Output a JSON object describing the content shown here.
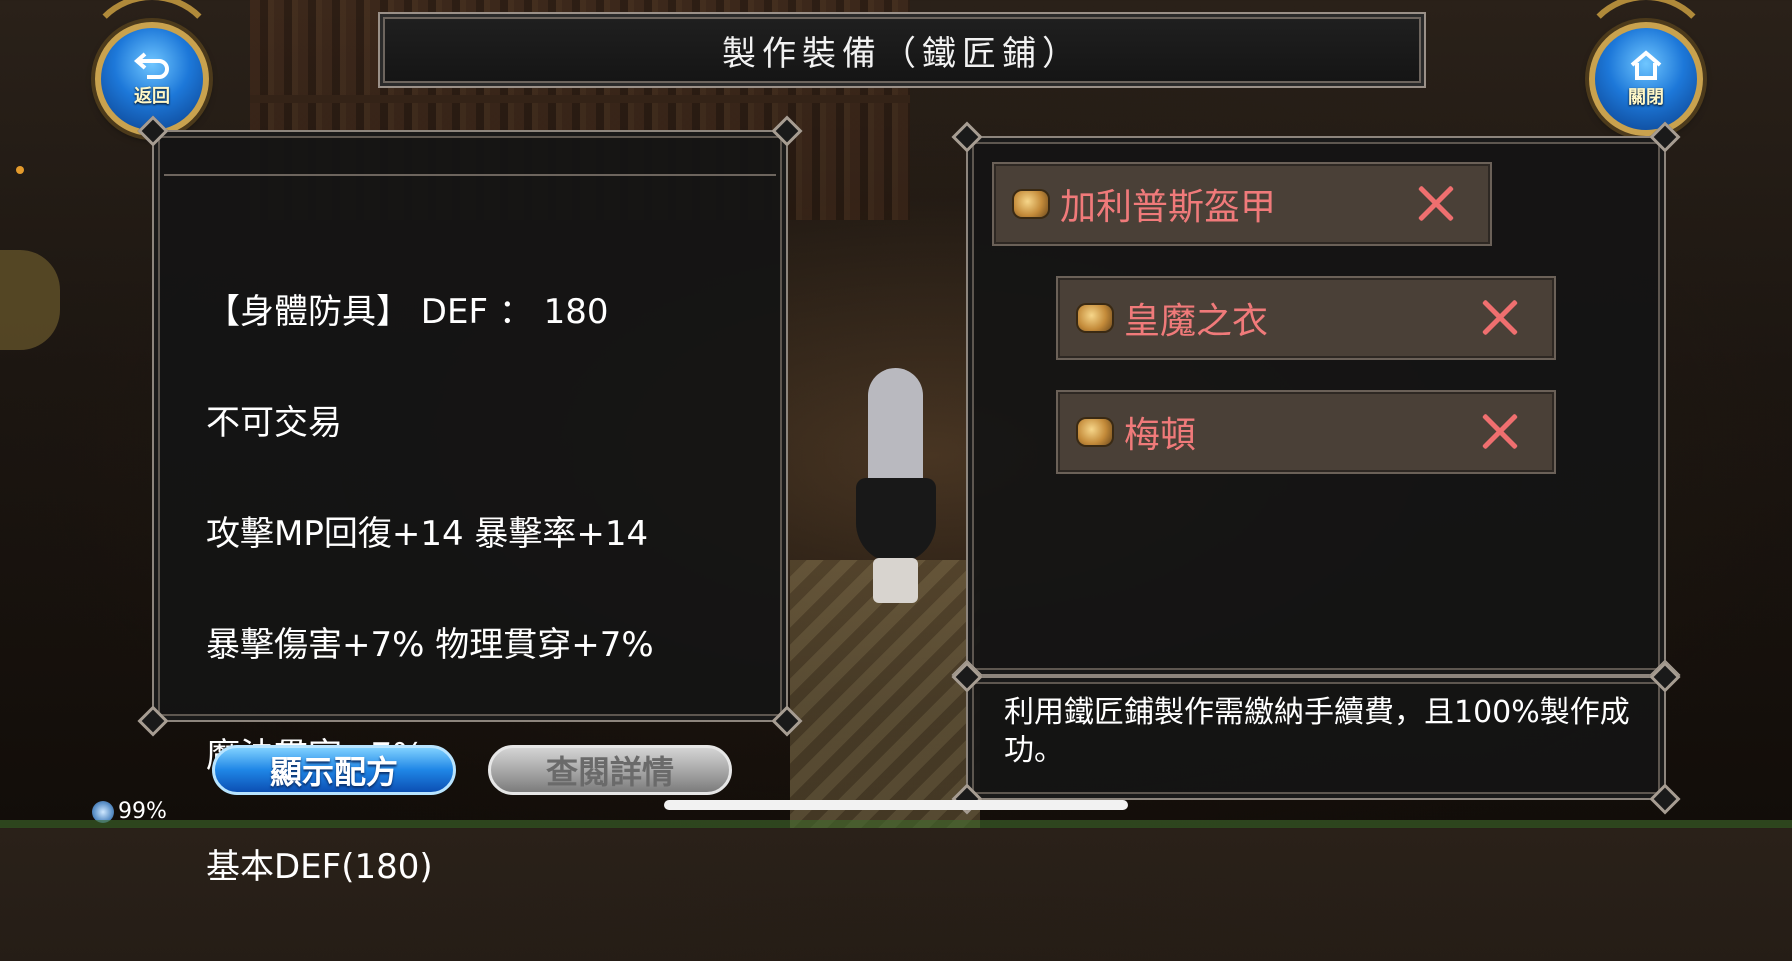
{
  "header": {
    "title": "製作裝備（鐵匠鋪）",
    "back_label": "返回",
    "close_label": "關閉"
  },
  "item_stats": {
    "lines": [
      "【身體防具】 DEF ： 180",
      "不可交易",
      "攻擊MP回復+14 暴擊率+14",
      "暴擊傷害+7% 物理貫穿+7%",
      "魔法貫穿+7%",
      "基本DEF(180)"
    ]
  },
  "materials": [
    {
      "name": "加利普斯盔甲",
      "icon": "armor-scroll-icon",
      "remove_icon": "close-x-icon"
    },
    {
      "name": "皇魔之衣",
      "icon": "armor-scroll-icon",
      "remove_icon": "close-x-icon"
    },
    {
      "name": "梅頓",
      "icon": "armor-scroll-icon",
      "remove_icon": "close-x-icon"
    }
  ],
  "note": "利用鐵匠鋪製作需繳納手續費，且100%製作成功。",
  "buttons": {
    "show_recipe": "顯示配方",
    "view_details": "查閱詳情"
  },
  "status": {
    "battery": "99%"
  },
  "colors": {
    "material_name": "#f07a7a",
    "remove_x": "#ef6f6f",
    "button_blue": "#1f86e6",
    "button_gray": "#a9a9a9"
  }
}
